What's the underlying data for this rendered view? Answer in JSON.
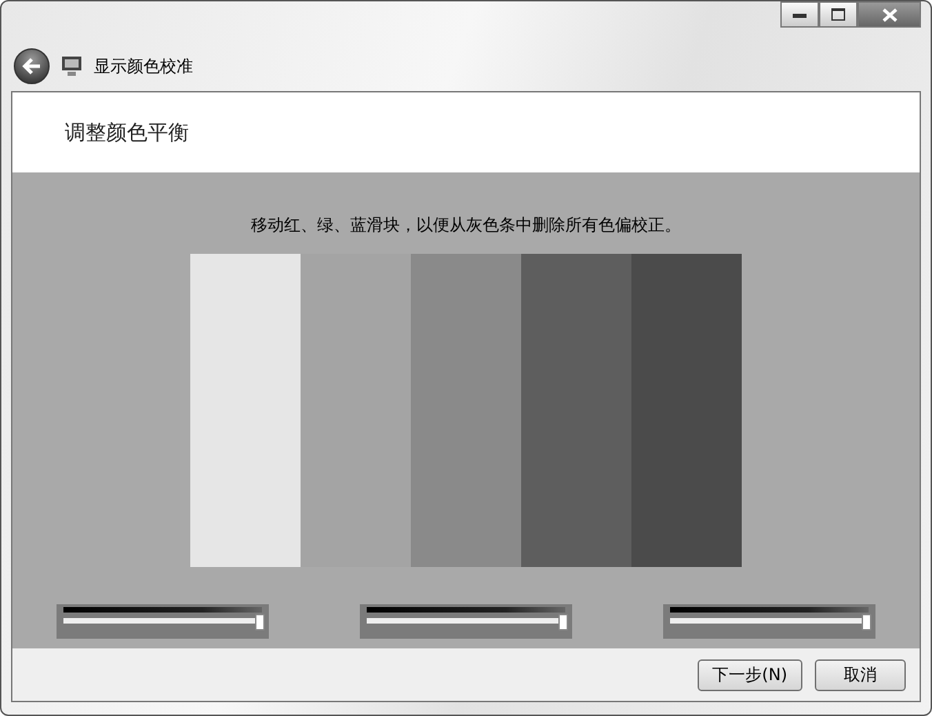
{
  "window": {
    "title": "显示颜色校准"
  },
  "heading": "调整颜色平衡",
  "instruction": "移动红、绿、蓝滑块，以便从灰色条中删除所有色偏校正。",
  "bars": [
    {
      "color": "#e6e6e6"
    },
    {
      "color": "#a4a4a4"
    },
    {
      "color": "#8a8a8a"
    },
    {
      "color": "#5e5e5e"
    },
    {
      "color": "#4b4b4b"
    }
  ],
  "sliders": [
    {
      "level": 1.0
    },
    {
      "level": 1.0
    },
    {
      "level": 1.0
    }
  ],
  "buttons": [
    "下一步(N)",
    "取消"
  ]
}
